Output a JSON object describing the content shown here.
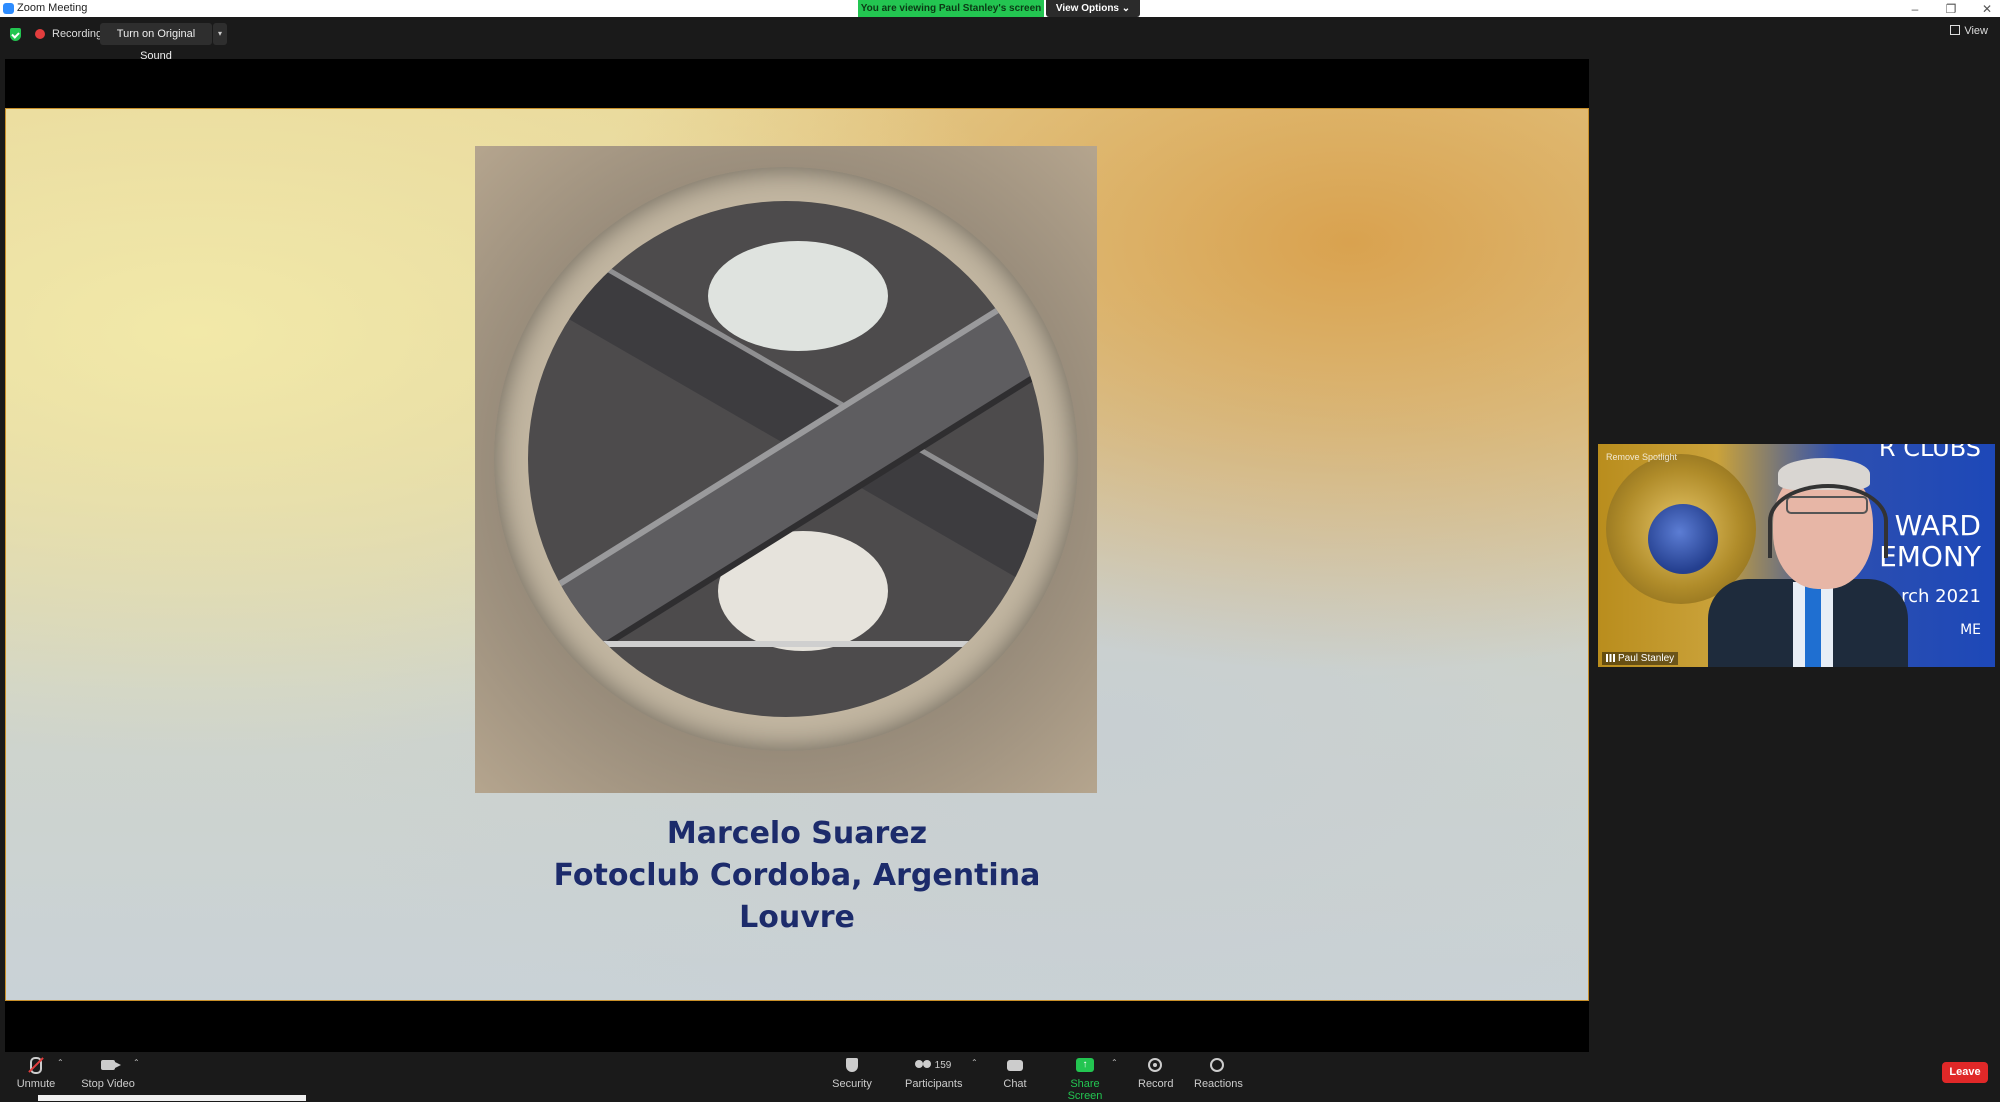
{
  "window": {
    "title": "Zoom Meeting"
  },
  "banner": {
    "viewing": "You are viewing Paul Stanley's screen",
    "view_options": "View Options"
  },
  "topbar": {
    "recording": "Recording",
    "original_sound": "Turn on Original Sound",
    "view": "View"
  },
  "slide": {
    "line1": "Marcelo Suarez",
    "line2": "Fotoclub Cordoba, Argentina",
    "line3": "Louvre"
  },
  "speaker": {
    "name": "Paul Stanley",
    "spotlight": "Remove Spotlight",
    "bg_text": [
      "R CLUBS",
      "WARD",
      "EMONY",
      "arch 2021",
      "ME"
    ]
  },
  "toolbar": {
    "unmute": "Unmute",
    "stop_video": "Stop Video",
    "security": "Security",
    "participants": "Participants",
    "participants_count": "159",
    "chat": "Chat",
    "share_screen": "Share Screen",
    "record": "Record",
    "reactions": "Reactions",
    "leave": "Leave"
  },
  "colors": {
    "share_green": "#23c551",
    "leave_red": "#e02828",
    "caption_navy": "#1c2b6b"
  }
}
